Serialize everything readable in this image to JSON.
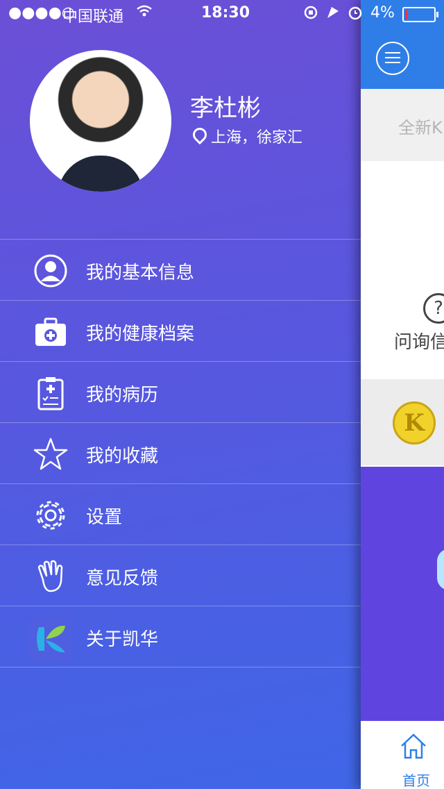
{
  "status_bar": {
    "signal": "●●●●○",
    "carrier": "中国联通",
    "time": "18:30",
    "battery": "4%",
    "battery_level": 0.04
  },
  "profile": {
    "name": "李杜彬",
    "location": "上海，徐家汇"
  },
  "menu": [
    {
      "label": "我的基本信息",
      "icon": "user-icon"
    },
    {
      "label": "我的健康档案",
      "icon": "medical-kit-icon"
    },
    {
      "label": "我的病历",
      "icon": "clipboard-icon"
    },
    {
      "label": "我的收藏",
      "icon": "star-icon"
    },
    {
      "label": "设置",
      "icon": "gear-icon"
    },
    {
      "label": "意见反馈",
      "icon": "hand-icon"
    },
    {
      "label": "关于凯华",
      "icon": "app-logo-icon"
    }
  ],
  "main": {
    "banner_text": "全新K",
    "ask_text": "问询信",
    "coin_letter": "K",
    "tab_home_label": "首页"
  },
  "colors": {
    "drawer_top": "#6b4fd6",
    "drawer_bottom": "#3f66e7",
    "main_header": "#2f7ee8"
  }
}
